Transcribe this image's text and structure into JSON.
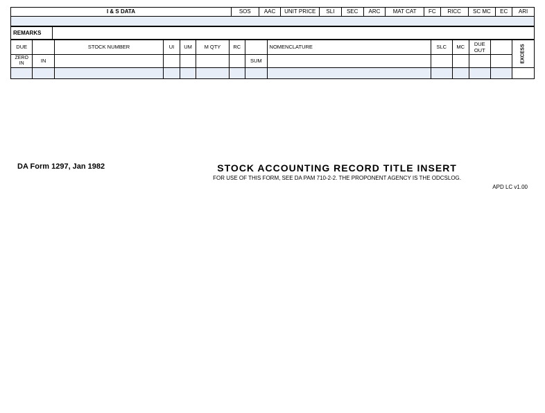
{
  "header": {
    "col_is_data": "I & S DATA",
    "col_sos": "SOS",
    "col_aac": "AAC",
    "col_unit_price": "UNIT PRICE",
    "col_sli": "SLI",
    "col_sec": "SEC",
    "col_arc": "ARC",
    "col_mat_cat": "MAT CAT",
    "col_fc": "FC",
    "col_ricc": "RICC",
    "col_sc_mc": "SC MC",
    "col_ec": "EC",
    "col_ari": "ARI"
  },
  "remarks": {
    "label": "REMARKS"
  },
  "main_table": {
    "col_due": "DUE",
    "col_stock_number": "STOCK NUMBER",
    "col_ui": "UI",
    "col_um": "UM",
    "col_m_qty": "M QTY",
    "col_rc": "RC",
    "col_sum": "SUM",
    "col_nomenclature": "NOMENCLATURE",
    "col_slc": "SLC",
    "col_mc": "MC",
    "col_due_out": "DUE OUT",
    "col_excess": "EXCESS",
    "row_zero_in": "ZERO IN"
  },
  "footer": {
    "form_id": "DA Form 1297, Jan 1982",
    "title": "STOCK ACCOUNTING RECORD TITLE INSERT",
    "subtitle": "FOR USE OF THIS FORM, SEE DA  PAM 710-2-2.  THE PROPONENT AGENCY IS THE ODCSLOG.",
    "version": "APD LC v1.00"
  }
}
